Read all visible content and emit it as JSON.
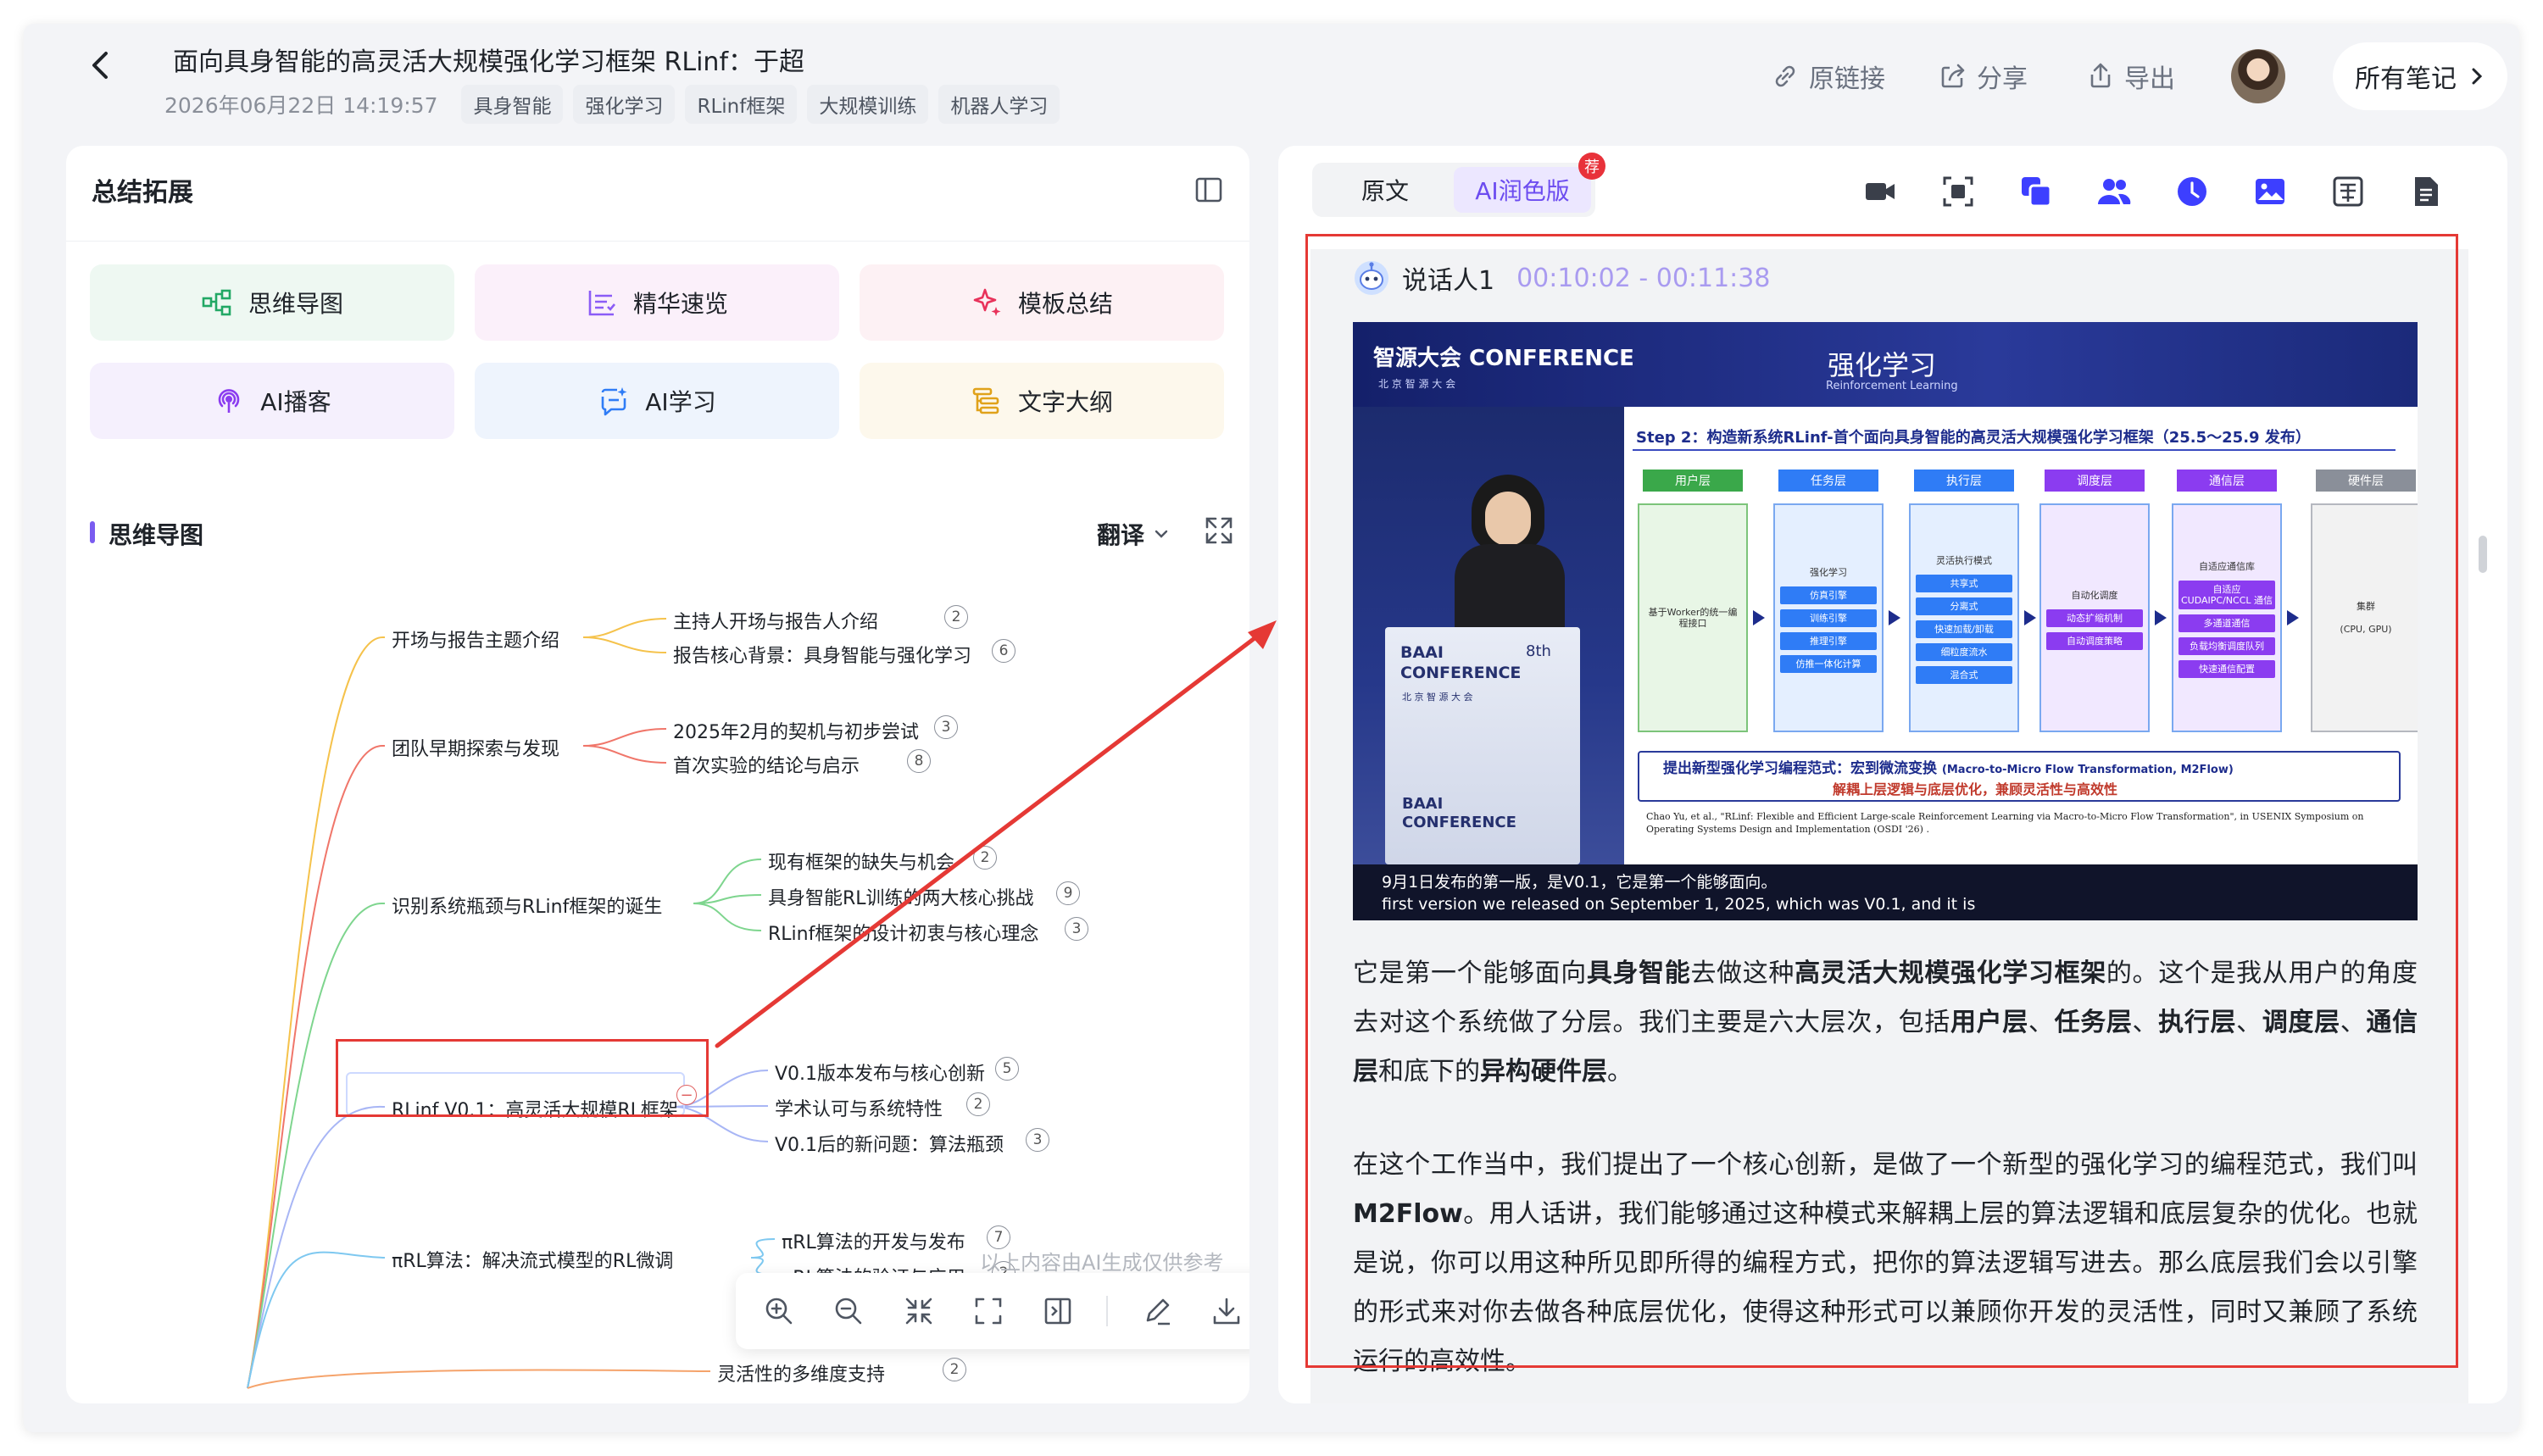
{
  "header": {
    "title": "面向具身智能的高灵活大规模强化学习框架 RLinf：于超",
    "datetime": "2026年06月22日 14:19:57",
    "tags": [
      "具身智能",
      "强化学习",
      "RLinf框架",
      "大规模训练",
      "机器人学习"
    ],
    "actions": {
      "link": "原链接",
      "share": "分享",
      "export": "导出"
    },
    "all_notes": "所有笔记"
  },
  "left_panel": {
    "title": "总结拓展",
    "functions": [
      "思维导图",
      "精华速览",
      "模板总结",
      "AI播客",
      "AI学习",
      "文字大纲"
    ],
    "section_title": "思维导图",
    "translate_label": "翻译",
    "ai_note": "以上内容由AI生成仅供参考"
  },
  "mindmap": {
    "branches": [
      {
        "label": "开场与报告主题介绍",
        "color": "#f5c24b",
        "children": [
          {
            "label": "主持人开场与报告人介绍",
            "count": "2"
          },
          {
            "label": "报告核心背景：具身智能与强化学习",
            "count": "6"
          }
        ]
      },
      {
        "label": "团队早期探索与发现",
        "color": "#f0766a",
        "children": [
          {
            "label": "2025年2月的契机与初步尝试",
            "count": "3"
          },
          {
            "label": "首次实验的结论与启示",
            "count": "8"
          }
        ]
      },
      {
        "label": "识别系统瓶颈与RLinf框架的诞生",
        "color": "#7ed58e",
        "children": [
          {
            "label": "现有框架的缺失与机会",
            "count": "2"
          },
          {
            "label": "具身智能RL训练的两大核心挑战",
            "count": "9"
          },
          {
            "label": "RLinf框架的设计初衷与核心理念",
            "count": "3"
          }
        ]
      },
      {
        "label": "RLinf V0.1：高灵活大规模RL框架",
        "color": "#a8b6f5",
        "children": [
          {
            "label": "V0.1版本发布与核心创新",
            "count": "5"
          },
          {
            "label": "学术认可与系统特性",
            "count": "2"
          },
          {
            "label": "V0.1后的新问题：算法瓶颈",
            "count": "3"
          }
        ]
      },
      {
        "label": "πRL算法：解决流式模型的RL微调",
        "color": "#7ec8f0",
        "children": [
          {
            "label": "πRL算法的开发与发布",
            "count": "7"
          },
          {
            "label": "πRL算法的验证与应用",
            "count": "2"
          }
        ]
      }
    ],
    "partial": {
      "label": "灵活性的多维度支持",
      "count": "2"
    }
  },
  "right_panel": {
    "tabs": [
      "原文",
      "AI润色版"
    ],
    "active_tab": "AI润色版",
    "tab_badge": "荐",
    "speaker": {
      "name": "说话人1",
      "time": "00:10:02 - 00:11:38"
    },
    "slide": {
      "logo_text": "智源大会 CONFERENCE",
      "logo_sub": "北 京 智 源 大 会",
      "header_title": "强化学习",
      "header_sub": "Reinforcement Learning",
      "step_title": "Step 2：构造新系统RLinf-首个面向具身智能的高灵活大规模强化学习框架（25.5～25.9 发布）",
      "columns": [
        "用户层",
        "任务层",
        "执行层",
        "调度层",
        "通信层",
        "硬件层"
      ],
      "user_box": "基于Worker的统一编程接口",
      "task_items": [
        "强化学习",
        "仿真引擎",
        "训练引擎",
        "推理引擎",
        "仿推一体化计算"
      ],
      "exec_items": [
        "灵活执行模式",
        "共享式",
        "分离式",
        "快速加载/卸载",
        "细粒度流水",
        "混合式"
      ],
      "sched_items": [
        "自动化调度",
        "动态扩缩机制",
        "自动调度策略"
      ],
      "comm_items": [
        "自适应通信库",
        "自适应 CUDAIPC/NCCL 通信",
        "多通道通信",
        "负载均衡调度队列",
        "快速通信配置"
      ],
      "hw_items": [
        "集群",
        "(CPU, GPU)"
      ],
      "banner_line1": "提出新型强化学习编程范式：宏到微流变换",
      "banner_line1_en": "(Macro-to-Micro Flow Transformation, M2Flow)",
      "banner_line2": "解耦上层逻辑与底层优化，兼顾灵活性与高效性",
      "citation": "Chao Yu, et al., \"RLinf: Flexible and Efficient Large-scale Reinforcement Learning via Macro-to-Micro Flow Transformation\", in USENIX Symposium on Operating Systems Design and Implementation (OSDI '26) .",
      "subtitle_cn": "9月1日发布的第一版，是V0.1，它是第一个能够面向。",
      "subtitle_en": "first version we released on September 1, 2025, which was V0.1, and it is",
      "podium_brand": "BAAI CONFERENCE",
      "podium_sub": "北 京 智 源 大 会",
      "podium_num": "8th",
      "podium_small": "BAAI CONFERENCE"
    },
    "paragraphs": [
      [
        "它是第一个能够面向",
        "!具身智能",
        "去做这种",
        "!高灵活大规模强化学习框架",
        "的。这个是我从用户的角度去对这个系统做了分层。我们主要是六大层次，包括",
        "!用户层",
        "、",
        "!任务层",
        "、",
        "!执行层",
        "、",
        "!调度层",
        "、",
        "!通信层",
        "和底下的",
        "!异构硬件层",
        "。"
      ],
      [
        "在这个工作当中，我们提出了一个核心创新，是做了一个新型的强化学习的编程范式，我们叫 ",
        "!M2Flow",
        "。用人话讲，我们能够通过这种模式来解耦上层的算法逻辑和底层复杂的优化。也就是说，你可以用这种所见即所得的编程方式，把你的算法逻辑写进去。那么底层我们会以引擎的形式来对你去做各种底层优化，使得这种形式可以兼顾你开发的灵活性，同时又兼顾了系统运行的高效性。"
      ]
    ]
  },
  "colors": {
    "accent": "#6c4cf0",
    "annotation": "#e53935",
    "blue_icon": "#3d3fff"
  }
}
